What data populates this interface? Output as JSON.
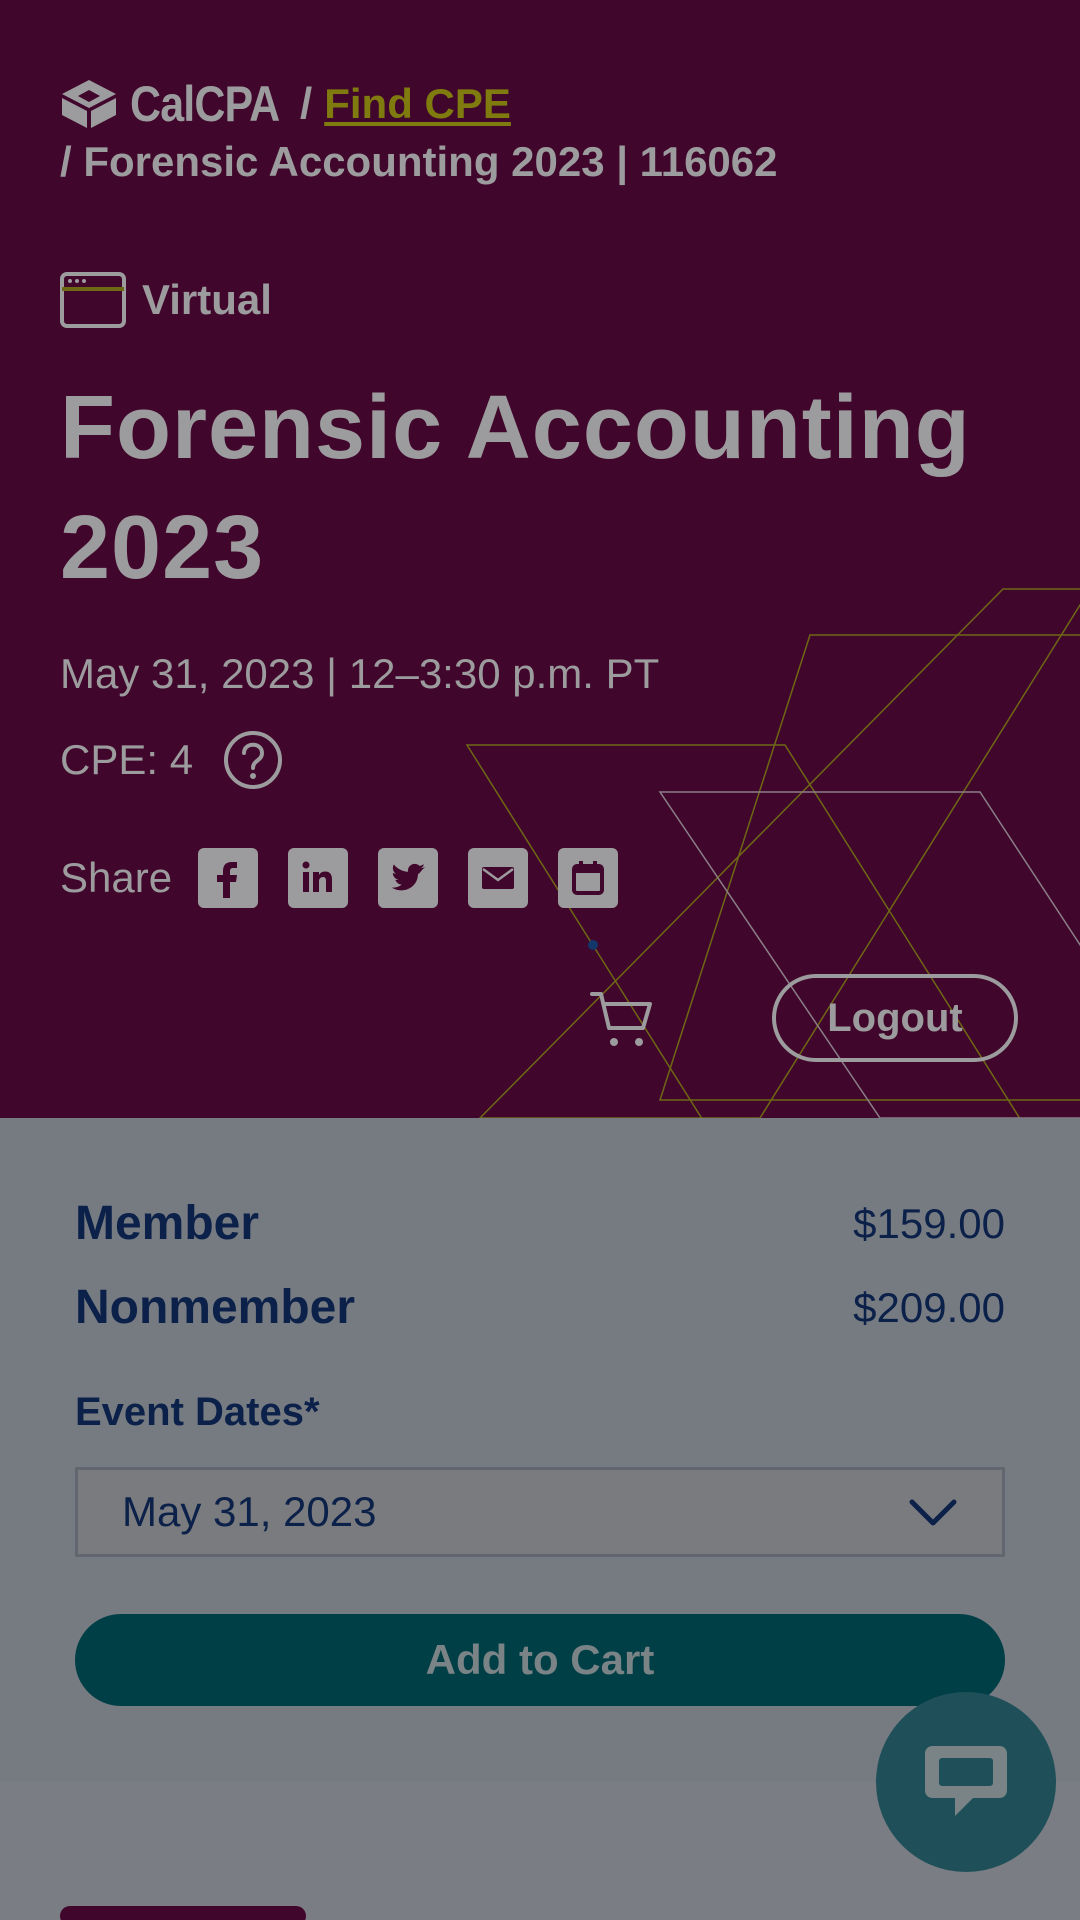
{
  "breadcrumb": {
    "logo_text": "CalCPA",
    "separator": "/",
    "link_label": "Find CPE",
    "current": "/ Forensic Accounting 2023 | 116062"
  },
  "event": {
    "format_label": "Virtual",
    "title": "Forensic Accounting 2023",
    "date_time": "May 31, 2023 | 12–3:30 p.m. PT",
    "cpe_label": "CPE: 4"
  },
  "share": {
    "label": "Share",
    "icons": [
      "facebook-icon",
      "linkedin-icon",
      "twitter-icon",
      "email-icon",
      "calendar-icon"
    ]
  },
  "header_actions": {
    "logout_label": "Logout"
  },
  "pricing": {
    "rows": [
      {
        "label": "Member",
        "value": "$159.00"
      },
      {
        "label": "Nonmember",
        "value": "$209.00"
      }
    ]
  },
  "registration": {
    "dates_label": "Event Dates*",
    "selected_date": "May 31, 2023",
    "add_to_cart_label": "Add to Cart"
  },
  "colors": {
    "hero_bg": "#41062b",
    "accent_link": "#7f7b0f",
    "button_teal": "#003f46",
    "text_navy": "#0c2149"
  }
}
